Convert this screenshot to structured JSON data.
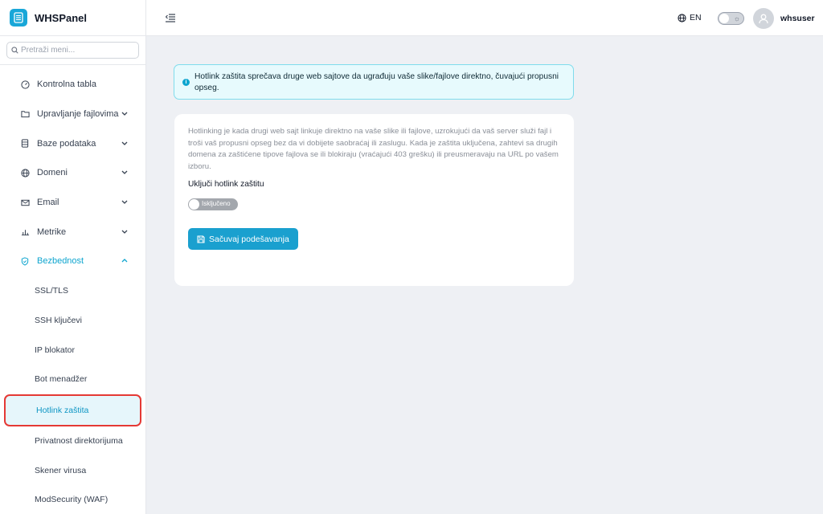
{
  "brand": {
    "name": "WHSPanel"
  },
  "search": {
    "placeholder": "Pretraži meni..."
  },
  "sidebar": {
    "items": [
      {
        "label": "Kontrolna tabla",
        "icon": "dashboard-icon",
        "has_chevron": false
      },
      {
        "label": "Upravljanje fajlovima",
        "icon": "folder-icon",
        "has_chevron": true
      },
      {
        "label": "Baze podataka",
        "icon": "database-icon",
        "has_chevron": true
      },
      {
        "label": "Domeni",
        "icon": "globe-icon",
        "has_chevron": true
      },
      {
        "label": "Email",
        "icon": "mail-icon",
        "has_chevron": true
      },
      {
        "label": "Metrike",
        "icon": "bar-chart-icon",
        "has_chevron": true
      },
      {
        "label": "Bezbednost",
        "icon": "shield-icon",
        "has_chevron": true,
        "expanded": true
      }
    ],
    "sub_items": [
      {
        "label": "SSL/TLS"
      },
      {
        "label": "SSH ključevi"
      },
      {
        "label": "IP blokator"
      },
      {
        "label": "Bot menadžer"
      },
      {
        "label": "Hotlink zaštita",
        "active": true
      },
      {
        "label": "Privatnost direktorijuma"
      },
      {
        "label": "Skener virusa"
      },
      {
        "label": "ModSecurity (WAF)"
      }
    ]
  },
  "topbar": {
    "language": "EN",
    "username": "whsuser"
  },
  "alert": {
    "text": "Hotlink zaštita sprečava druge web sajtove da ugrađuju vaše slike/fajlove direktno, čuvajući propusni opseg."
  },
  "card": {
    "description": "Hotlinking je kada drugi web sajt linkuje direktno na vaše slike ili fajlove, uzrokujući da vaš server služi fajl i troši vaš propusni opseg bez da vi dobijete saobraćaj ili zaslugu. Kada je zaštita uključena, zahtevi sa drugih domena za zaštićene tipove fajlova se ili blokiraju (vraćajući 403 grešku) ili preusmeravaju na URL po vašem izboru.",
    "toggle_label": "Uključi hotlink zaštitu",
    "toggle_state": "Isključeno",
    "save_label": "Sačuvaj podešavanja"
  },
  "colors": {
    "accent": "#19a7d8",
    "active_highlight_border": "#e53935"
  }
}
